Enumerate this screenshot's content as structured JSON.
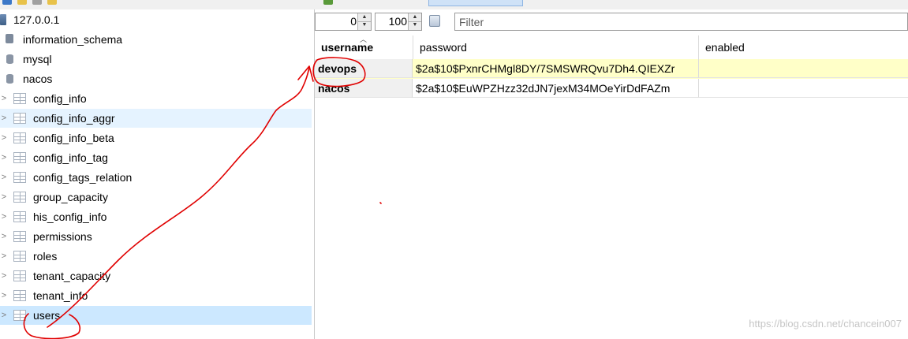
{
  "tree": {
    "server": "127.0.0.1",
    "items": [
      {
        "label": "information_schema",
        "type": "db-info"
      },
      {
        "label": "mysql",
        "type": "db"
      },
      {
        "label": "nacos",
        "type": "db"
      },
      {
        "label": "config_info",
        "type": "table"
      },
      {
        "label": "config_info_aggr",
        "type": "table"
      },
      {
        "label": "config_info_beta",
        "type": "table"
      },
      {
        "label": "config_info_tag",
        "type": "table"
      },
      {
        "label": "config_tags_relation",
        "type": "table"
      },
      {
        "label": "group_capacity",
        "type": "table"
      },
      {
        "label": "his_config_info",
        "type": "table"
      },
      {
        "label": "permissions",
        "type": "table"
      },
      {
        "label": "roles",
        "type": "table"
      },
      {
        "label": "tenant_capacity",
        "type": "table"
      },
      {
        "label": "tenant_info",
        "type": "table"
      },
      {
        "label": "users",
        "type": "table"
      }
    ]
  },
  "nav": {
    "offset": "0",
    "limit": "100",
    "filter_placeholder": "Filter"
  },
  "grid": {
    "columns": [
      "username",
      "password",
      "enabled"
    ],
    "rows": [
      {
        "username": "devops",
        "password": "$2a$10$PxnrCHMgl8DY/7SMSWRQvu7Dh4.QIEXZr",
        "enabled": ""
      },
      {
        "username": "nacos",
        "password": "$2a$10$EuWPZHzz32dJN7jexM34MOeYirDdFAZm",
        "enabled": ""
      }
    ]
  },
  "watermark": "https://blog.csdn.net/chancein007",
  "colors": {
    "selection": "#cce8ff",
    "row_highlight": "#ffffc8",
    "annotation": "#e00000"
  }
}
